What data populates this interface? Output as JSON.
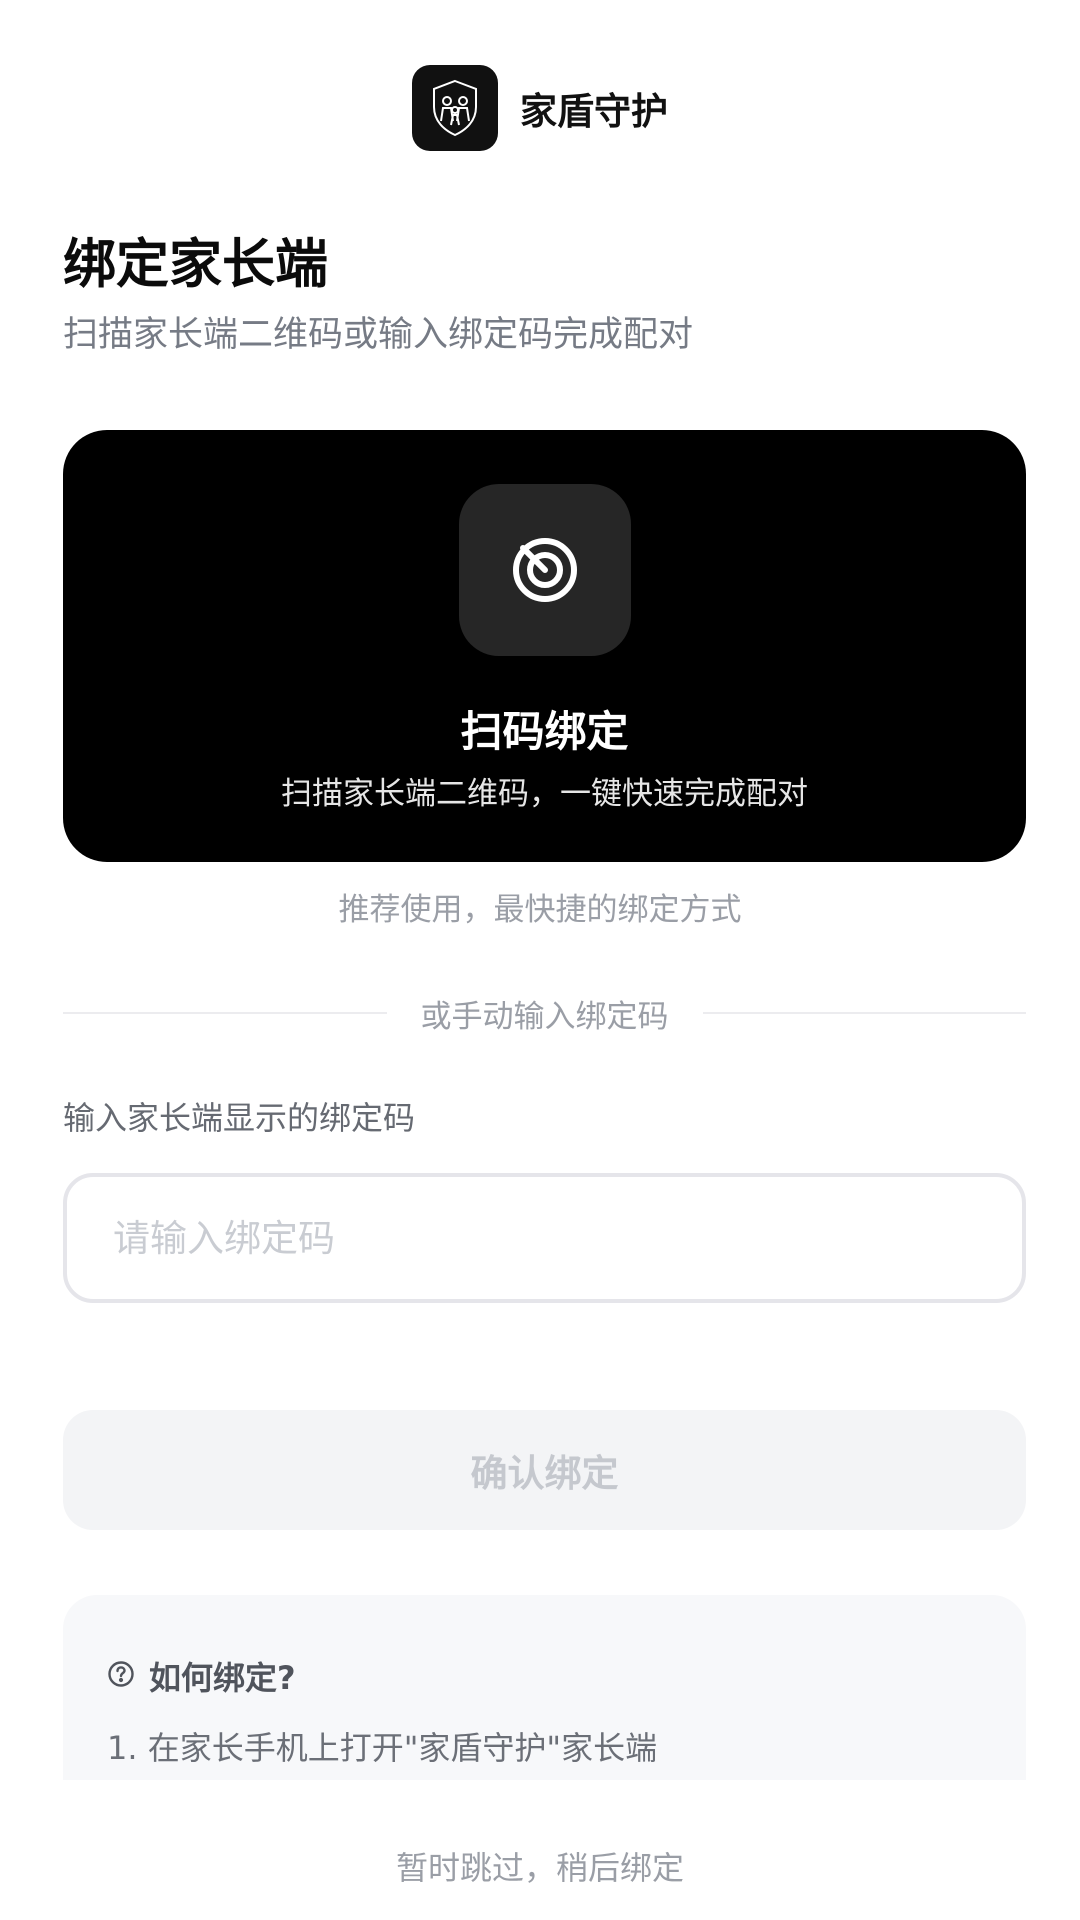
{
  "header": {
    "app_name": "家盾守护",
    "logo_icon": "family-shield-icon"
  },
  "intro": {
    "title": "绑定家长端",
    "subtitle": "扫描家长端二维码或输入绑定码完成配对"
  },
  "scan_card": {
    "icon": "scan-target-icon",
    "title": "扫码绑定",
    "description": "扫描家长端二维码，一键快速完成配对"
  },
  "recommend_note": "推荐使用，最快捷的绑定方式",
  "divider_text": "或手动输入绑定码",
  "code_entry": {
    "label": "输入家长端显示的绑定码",
    "placeholder": "请输入绑定码",
    "value": ""
  },
  "confirm_button": {
    "label": "确认绑定"
  },
  "help": {
    "icon": "question-circle-icon",
    "title": "如何绑定?",
    "steps": [
      "1. 在家长手机上打开\"家盾守护\"家长端"
    ]
  },
  "skip_link": "暂时跳过，稍后绑定",
  "colors": {
    "primary": "#000000",
    "card_icon_bg": "#262626",
    "muted_text": "#9a9ea6",
    "disabled_bg": "#f3f4f6",
    "disabled_text": "#c5c8ce"
  }
}
